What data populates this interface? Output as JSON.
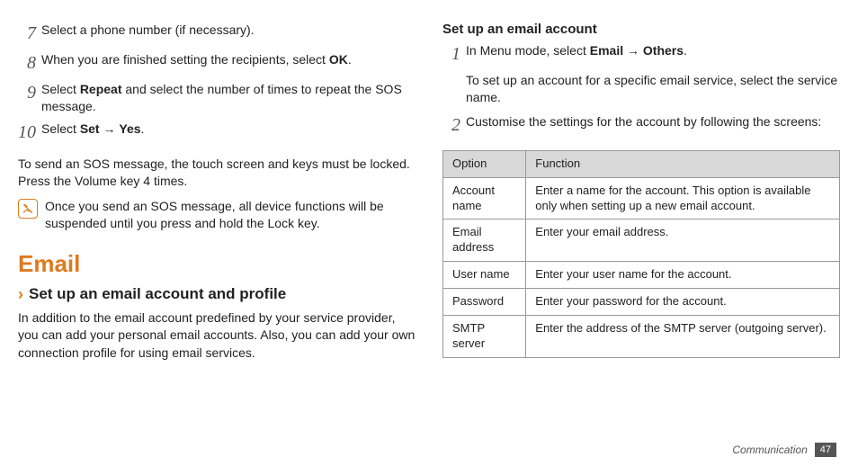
{
  "left": {
    "steps": [
      {
        "num": "7",
        "text_parts": [
          "Select a phone number (if necessary)."
        ]
      },
      {
        "num": "8",
        "text_parts": [
          "When you are finished setting the recipients, select ",
          {
            "b": "OK"
          },
          "."
        ]
      },
      {
        "num": "9",
        "text_parts": [
          "Select ",
          {
            "b": "Repeat"
          },
          " and select the number of times to repeat the SOS message."
        ]
      },
      {
        "num": "10",
        "text_parts": [
          "Select ",
          {
            "b": "Set"
          },
          " → ",
          {
            "b": "Yes"
          },
          "."
        ]
      }
    ],
    "para": "To send an SOS message, the touch screen and keys must be locked. Press the Volume key 4 times.",
    "note": "Once you send an SOS message, all device functions will be suspended until you press and hold the Lock key.",
    "h1": "Email",
    "h2": "Set up an email account and profile",
    "h2_body": "In addition to the email account predefined by your service provider, you can add your personal email accounts. Also, you can add your own connection profile for using email services."
  },
  "right": {
    "h3": "Set up an email account",
    "steps": [
      {
        "num": "1",
        "line_parts": [
          "In Menu mode, select ",
          {
            "b": "Email"
          },
          " → ",
          {
            "b": "Others"
          },
          "."
        ],
        "sub": "To set up an account for a specific email service, select the service name."
      },
      {
        "num": "2",
        "line_parts": [
          "Customise the settings for the account by following the screens:"
        ]
      }
    ],
    "table": {
      "head": [
        "Option",
        "Function"
      ],
      "rows": [
        [
          "Account name",
          "Enter a name for the account. This option is available only when setting up a new email account."
        ],
        [
          "Email address",
          "Enter your email address."
        ],
        [
          "User name",
          "Enter your user name for the account."
        ],
        [
          "Password",
          "Enter your password for the account."
        ],
        [
          "SMTP server",
          "Enter the address of the SMTP server (outgoing server)."
        ]
      ]
    }
  },
  "footer": {
    "section": "Communication",
    "page": "47"
  }
}
